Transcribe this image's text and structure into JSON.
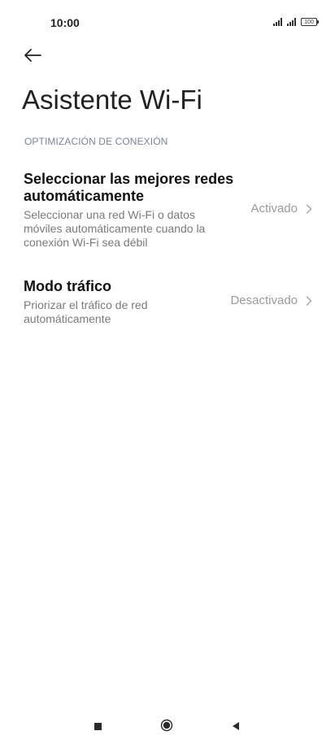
{
  "status_bar": {
    "time": "10:00",
    "battery": "100"
  },
  "header": {
    "title": "Asistente Wi-Fi"
  },
  "section": {
    "header": "OPTIMIZACIÓN DE CONEXIÓN"
  },
  "settings": [
    {
      "title_line1": "Seleccionar las mejores redes",
      "title_line2": "automáticamente",
      "desc_line1": "Seleccionar una red Wi-Fi o datos",
      "desc_line2": "móviles automáticamente cuando la",
      "desc_line3": "conexión Wi-Fi sea débil",
      "value": "Activado"
    },
    {
      "title_line1": "Modo tráfico",
      "desc_line1": "Priorizar el tráfico de red",
      "desc_line2": "automáticamente",
      "value": "Desactivado"
    }
  ],
  "icons": {
    "back": "back-arrow-icon",
    "chevron": "chevron-right-icon",
    "signal": "cellular-signal-icon",
    "battery": "battery-icon",
    "nav_recents": "square-icon",
    "nav_home": "circle-icon",
    "nav_back": "triangle-back-icon"
  }
}
